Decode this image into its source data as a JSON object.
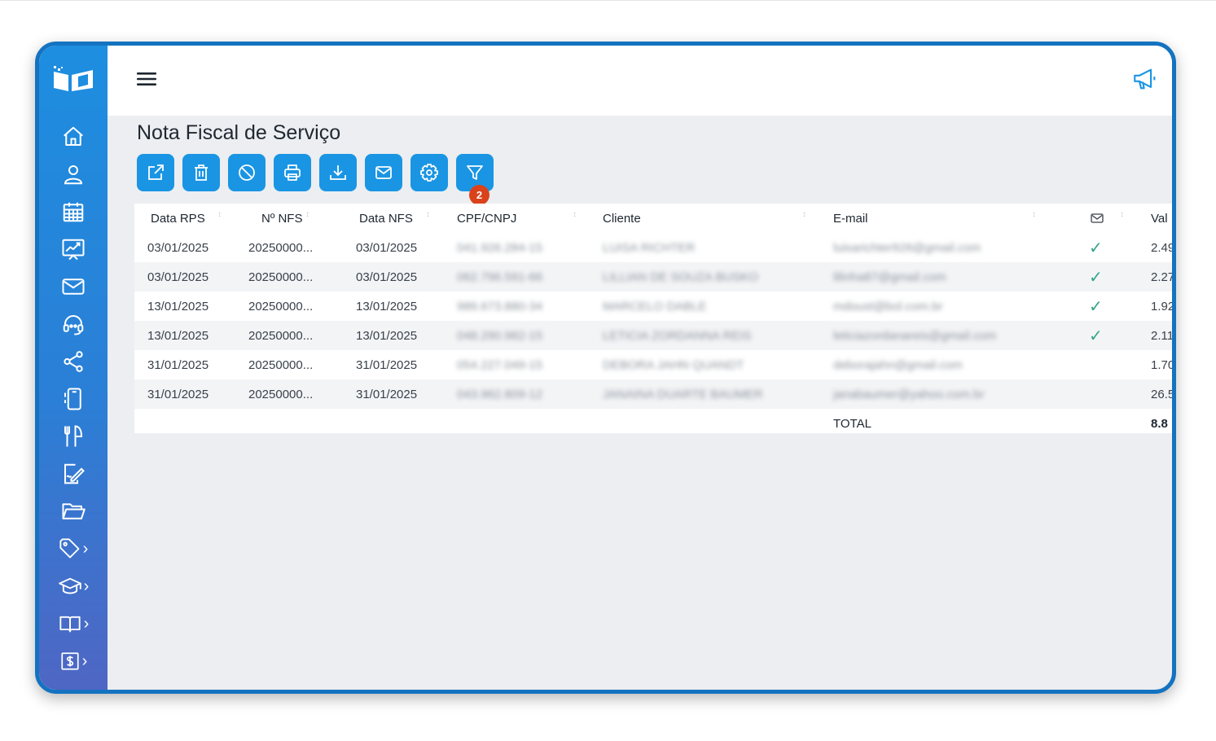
{
  "page": {
    "title": "Nota Fiscal de Serviço"
  },
  "toolbar": {
    "buttons": [
      {
        "icon": "external-link-icon"
      },
      {
        "icon": "trash-icon"
      },
      {
        "icon": "cancel-icon"
      },
      {
        "icon": "printer-icon"
      },
      {
        "icon": "download-icon"
      },
      {
        "icon": "mail-icon"
      },
      {
        "icon": "gear-icon"
      },
      {
        "icon": "filter-icon"
      }
    ],
    "filter_badge": "2"
  },
  "sidebar": {
    "items": [
      {
        "icon": "home-icon"
      },
      {
        "icon": "user-icon"
      },
      {
        "icon": "calendar-icon"
      },
      {
        "icon": "chart-icon"
      },
      {
        "icon": "mail-icon"
      },
      {
        "icon": "support-headset-icon"
      },
      {
        "icon": "share-icon"
      },
      {
        "icon": "mobile-icon"
      },
      {
        "icon": "restaurant-icon"
      },
      {
        "icon": "signature-icon"
      },
      {
        "icon": "folder-icon"
      },
      {
        "icon": "tag-icon",
        "chevron": "›"
      },
      {
        "icon": "graduation-cap-icon",
        "chevron": "›"
      },
      {
        "icon": "book-icon",
        "chevron": "›"
      },
      {
        "icon": "dollar-icon",
        "chevron": "›"
      }
    ]
  },
  "table": {
    "headers": {
      "data_rps": "Data RPS",
      "n_nfs": "Nº NFS",
      "data_nfs": "Data NFS",
      "cpf_cnpj": "CPF/CNPJ",
      "cliente": "Cliente",
      "email": "E-mail",
      "valor": "Val"
    },
    "rows": [
      {
        "data_rps": "03/01/2025",
        "n_nfs": "20250000...",
        "data_nfs": "03/01/2025",
        "cpf": "041.926.284-15",
        "cliente": "LUISA RICHTER",
        "email": "luisarichter926@gmail.com",
        "sent": "✓",
        "valor": "2.49"
      },
      {
        "data_rps": "03/01/2025",
        "n_nfs": "20250000...",
        "data_nfs": "03/01/2025",
        "cpf": "062.796.591-66",
        "cliente": "LILLIAN DE SOUZA BUSKO",
        "email": "lilinha87@gmail.com",
        "sent": "✓",
        "valor": "2.27"
      },
      {
        "data_rps": "13/01/2025",
        "n_nfs": "20250000...",
        "data_nfs": "13/01/2025",
        "cpf": "989.673.880-34",
        "cliente": "MARCELO DABLE",
        "email": "mdoust@bol.com.br",
        "sent": "✓",
        "valor": "1.92"
      },
      {
        "data_rps": "13/01/2025",
        "n_nfs": "20250000...",
        "data_nfs": "13/01/2025",
        "cpf": "048.290.982-15",
        "cliente": "LETICIA ZORDANNA REIS",
        "email": "leticiazordanareis@gmail.com",
        "sent": "✓",
        "valor": "2.11"
      },
      {
        "data_rps": "31/01/2025",
        "n_nfs": "20250000...",
        "data_nfs": "31/01/2025",
        "cpf": "054.227.049-15",
        "cliente": "DEBORA JAHN QUANDT",
        "email": "deborajahn@gmail.com",
        "sent": "",
        "valor": "1.70"
      },
      {
        "data_rps": "31/01/2025",
        "n_nfs": "20250000...",
        "data_nfs": "31/01/2025",
        "cpf": "043.962.809-12",
        "cliente": "JANAINA DUARTE BAUMER",
        "email": "janabaumer@yahoo.com.br",
        "sent": "",
        "valor": "26.5"
      }
    ],
    "total_label": "TOTAL",
    "total_value": "8.8"
  },
  "colors": {
    "frame": "#1473c0",
    "sidebar_top": "#1d8ee0",
    "sidebar_bottom": "#4f66c4",
    "button": "#1a95e4",
    "badge": "#d9421b",
    "check": "#2fa48a"
  }
}
